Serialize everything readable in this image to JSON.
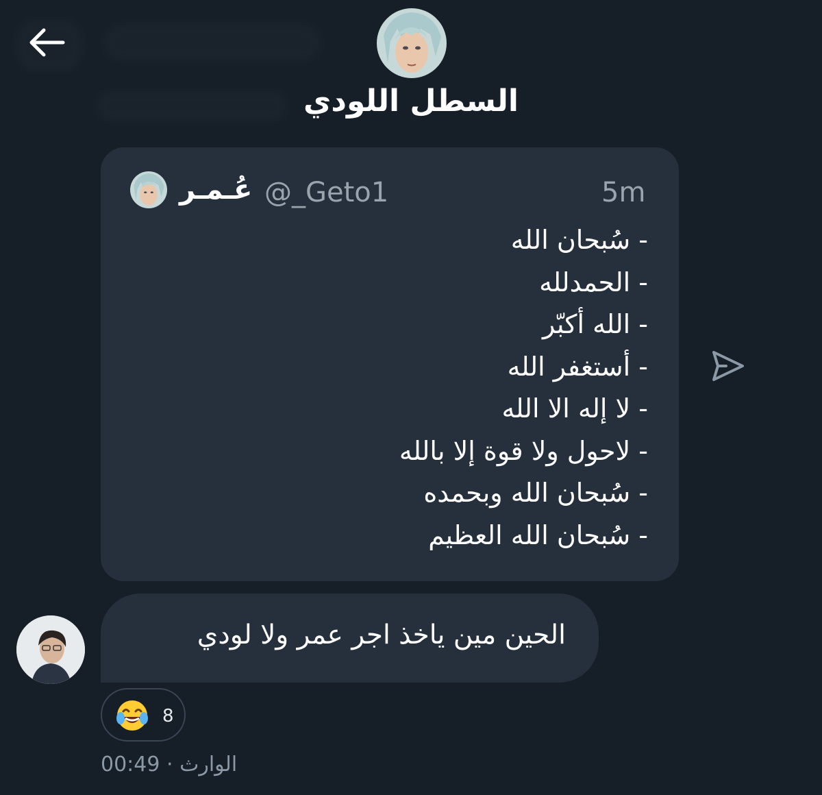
{
  "header": {
    "title": "السطل اللودي",
    "avatar_icon": "anime-avatar-icon",
    "back_icon": "arrow-left-icon"
  },
  "quoted_post": {
    "author_name": "عُـمـر",
    "handle": "@_Geto1",
    "time": "5m",
    "lines": [
      "- سُبحان الله",
      "- الحمدلله",
      "- الله أكبّر",
      "- أستغفر الله",
      "- لا إله الا الله",
      "- لاحول ولا قوة إلا بالله",
      "- سُبحان الله وبحمده",
      "- سُبحان الله العظيم"
    ],
    "share_icon": "send-icon"
  },
  "message": {
    "text": "الحين مين ياخذ اجر عمر ولا لودي",
    "reaction": {
      "emoji": "😂",
      "count": "8"
    },
    "time": "00:49",
    "separator": "·",
    "sender": "الوارث"
  },
  "colors": {
    "background": "#161e27",
    "bubble": "#26303c",
    "muted_text": "#8b98a5"
  }
}
